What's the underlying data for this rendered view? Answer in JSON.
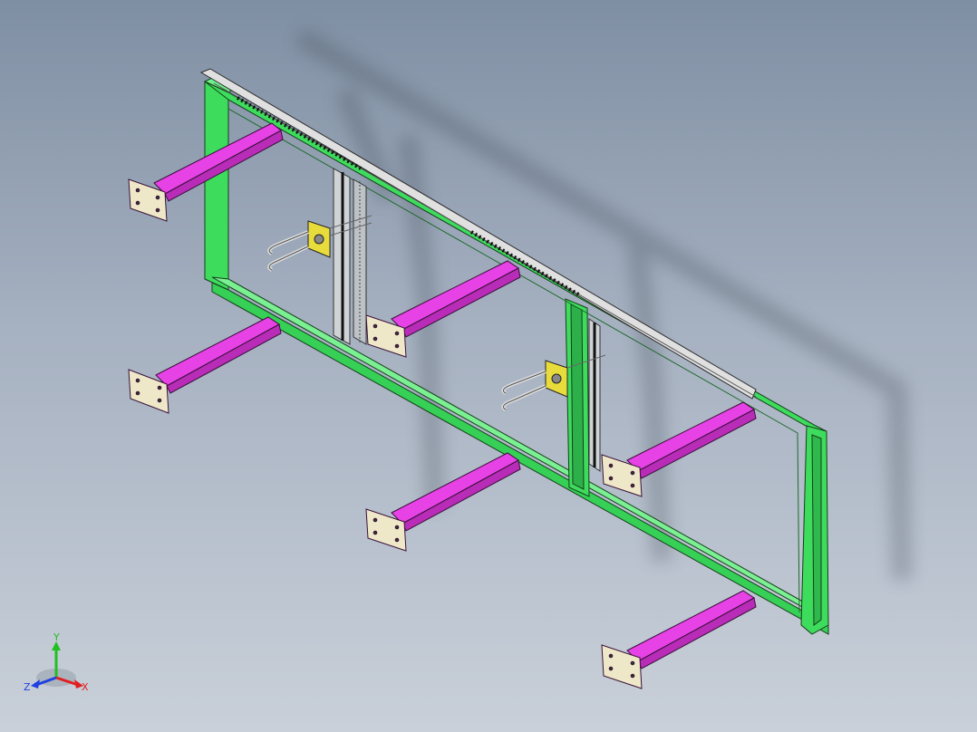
{
  "viewport": {
    "background_top": "#7f8fa3",
    "background_bottom": "#c9d0d9",
    "frame_color": "#35e05a",
    "arm_color": "#e642e6",
    "plate_color": "#eee8c8",
    "bracket_color": "#e8dc3c"
  },
  "triad": {
    "x_label": "X",
    "y_label": "Y",
    "z_label": "Z",
    "x_color": "#e02020",
    "y_color": "#20c020",
    "z_color": "#2040e0"
  }
}
